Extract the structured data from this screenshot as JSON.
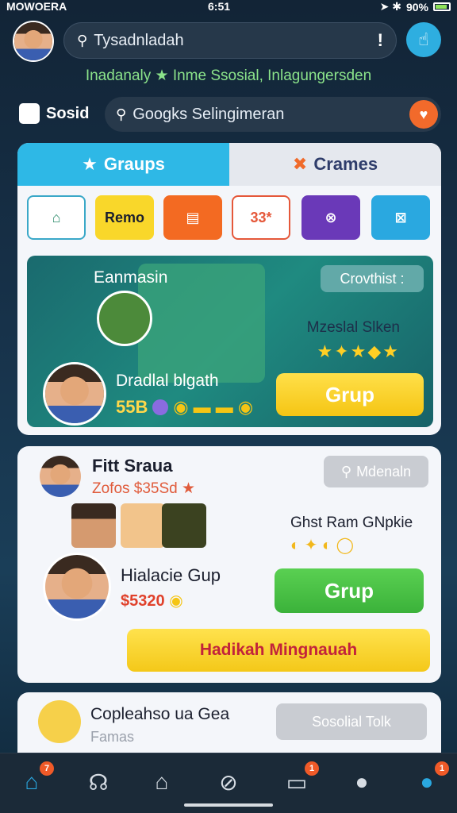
{
  "status": {
    "carrier": "MOWOERA",
    "time": "6:51",
    "battery": "90%"
  },
  "header": {
    "search_text": "Tysadnladah",
    "alert": "!"
  },
  "tagline": "Inadanaly ★ Inme Ssosial, Inlagungersden",
  "social": {
    "label": "Sosid",
    "search_text": "Googks Selingimeran"
  },
  "tabs": [
    {
      "label": "Graups"
    },
    {
      "label": "Crames"
    }
  ],
  "chips": [
    {
      "label": ""
    },
    {
      "label": "Remo"
    },
    {
      "label": ""
    },
    {
      "label": "33*"
    },
    {
      "label": ""
    },
    {
      "label": ""
    }
  ],
  "banner": {
    "title": "Eanmasin",
    "pill": "Crovthist  :",
    "subtitle": "Mzeslal Slken",
    "stars": "★✦★◆★",
    "name": "Dradlal blgath",
    "score": "55B",
    "button": "Grup"
  },
  "card2": {
    "name": "Fitt Sraua",
    "sub": "Zofos $35Sd ★",
    "pill": "Mdenaln",
    "mid_text": "Ghst Ram GNpkie",
    "mid_icons": "◐ ✦ ◐ ◯",
    "host_name": "Hialacie Gup",
    "host_score": "$5320",
    "button": "Grup",
    "wide_button": "Hadikah Mingnauah"
  },
  "card3": {
    "title": "Copleahso ua Gea",
    "sub": "Famas",
    "pill": "Sosolial Tolk"
  },
  "nav": {
    "badges": [
      "7",
      "1",
      "1"
    ]
  },
  "colors": {
    "accent": "#2eb8e6",
    "green": "#3bb23a",
    "yellow": "#f5c514",
    "orange": "#f26a2b"
  }
}
